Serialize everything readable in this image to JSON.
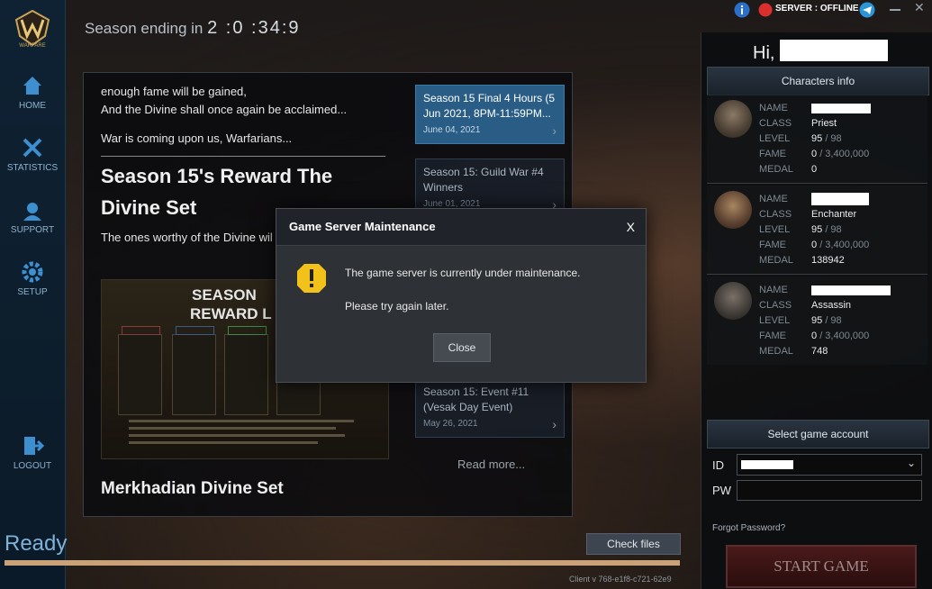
{
  "sidebar": {
    "logo_text": "WARFARE",
    "items": [
      {
        "label": "HOME"
      },
      {
        "label": "STATISTICS"
      },
      {
        "label": "SUPPORT"
      },
      {
        "label": "SETUP"
      },
      {
        "label": "LOGOUT"
      }
    ]
  },
  "header": {
    "season_prefix": "Season ending in",
    "season_countdown": "2 :0 :34:9",
    "server_status": "SERVER : OFFLINE",
    "status_color": "#d9302e"
  },
  "article": {
    "line1": "enough fame will be gained,",
    "line2": "And the Divine shall once again be acclaimed...",
    "line3": "War is coming upon us, Warfarians...",
    "heading": "Season 15's Reward The Divine Set",
    "body": "The ones worthy of the Divine wil",
    "poster_title_line1": "SEASON",
    "poster_title_line2": "REWARD L",
    "footer_heading": "Merkhadian Divine Set"
  },
  "news": {
    "items": [
      {
        "title": "Season 15 Final 4 Hours (5 Jun 2021, 8PM-11:59PM...",
        "date": "June 04, 2021",
        "active": true
      },
      {
        "title": "Season 15: Guild War #4 Winners",
        "date": "June 01, 2021",
        "active": false
      },
      {
        "title": "Season 15: Event #11 (Vesak Day Event)",
        "date": "May 26, 2021",
        "active": false
      }
    ],
    "read_more": "Read more..."
  },
  "account_panel": {
    "greeting": "Hi,",
    "characters_header": "Characters info",
    "labels": {
      "name": "NAME",
      "class": "CLASS",
      "level": "LEVEL",
      "fame": "FAME",
      "medal": "MEDAL"
    },
    "characters": [
      {
        "class": "Priest",
        "level": "95",
        "level_max": "/ 98",
        "fame": "0",
        "fame_max": "/ 3,400,000",
        "medal": "0"
      },
      {
        "class": "Enchanter",
        "level": "95",
        "level_max": "/ 98",
        "fame": "0",
        "fame_max": "/ 3,400,000",
        "medal": "138942"
      },
      {
        "class": "Assassin",
        "level": "95",
        "level_max": "/ 98",
        "fame": "0",
        "fame_max": "/ 3,400,000",
        "medal": "748"
      }
    ],
    "select_header": "Select game account",
    "id_label": "ID",
    "pw_label": "PW",
    "forgot": "Forgot Password?",
    "start": "START GAME"
  },
  "modal": {
    "title": "Game Server Maintenance",
    "close_x": "X",
    "message1": "The game server is currently under maintenance.",
    "message2": "Please try again later.",
    "close_button": "Close"
  },
  "footer": {
    "status": "Ready",
    "progress": 1.0,
    "check_files": "Check files",
    "client_version": "Client v 768-e1f8-c721-62e9"
  }
}
